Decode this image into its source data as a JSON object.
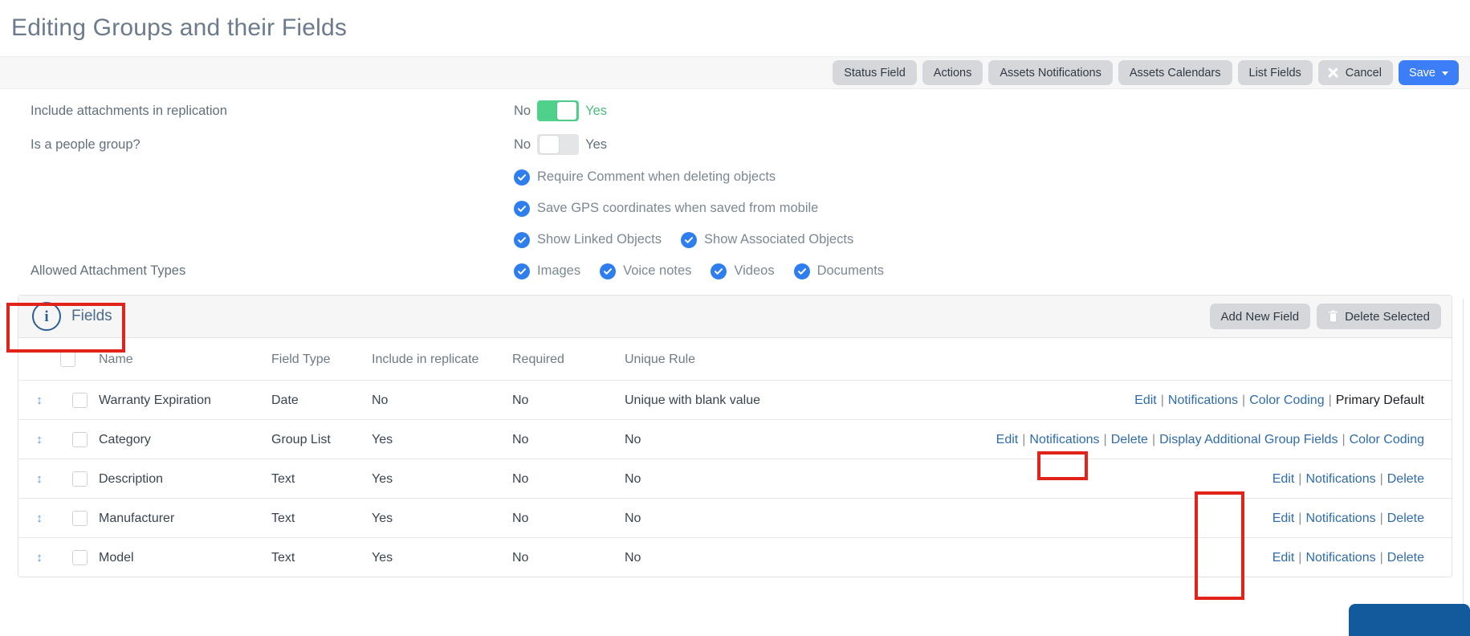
{
  "page_title": "Editing Groups and their Fields",
  "toolbar": {
    "buttons": [
      {
        "label": "Status Field"
      },
      {
        "label": "Actions"
      },
      {
        "label": "Assets Notifications"
      },
      {
        "label": "Assets Calendars"
      },
      {
        "label": "List Fields"
      }
    ],
    "cancel_label": "Cancel",
    "save_label": "Save"
  },
  "settings": {
    "rows": [
      {
        "label": "Include attachments in replication",
        "off_label": "No",
        "on_label": "Yes",
        "state": "on"
      },
      {
        "label": "Is a people group?",
        "off_label": "No",
        "on_label": "Yes",
        "state": "off"
      }
    ],
    "checkboxes": [
      {
        "label": "Require Comment when deleting objects",
        "checked": true
      },
      {
        "label": "Save GPS coordinates when saved from mobile",
        "checked": true
      }
    ],
    "object_options": [
      {
        "label": "Show Linked Objects",
        "checked": true
      },
      {
        "label": "Show Associated Objects",
        "checked": true
      }
    ],
    "attachment_types_label": "Allowed Attachment Types",
    "attachment_types": [
      {
        "label": "Images",
        "checked": true
      },
      {
        "label": "Voice notes",
        "checked": true
      },
      {
        "label": "Videos",
        "checked": true
      },
      {
        "label": "Documents",
        "checked": true
      }
    ]
  },
  "fields_panel": {
    "title": "Fields",
    "info_icon_glyph": "i",
    "add_new_field_label": "Add New Field",
    "delete_selected_label": "Delete Selected",
    "columns": [
      "Name",
      "Field Type",
      "Include in replicate",
      "Required",
      "Unique Rule"
    ],
    "rows": [
      {
        "name": "Warranty Expiration",
        "field_type": "Date",
        "include_in_replicate": "No",
        "required": "No",
        "unique_rule": "Unique with blank value",
        "actions": [
          {
            "label": "Edit",
            "type": "link"
          },
          {
            "label": "Notifications",
            "type": "link"
          },
          {
            "label": "Color Coding",
            "type": "link"
          },
          {
            "label": "Primary Default",
            "type": "static"
          }
        ]
      },
      {
        "name": "Category",
        "field_type": "Group List",
        "include_in_replicate": "Yes",
        "required": "No",
        "unique_rule": "No",
        "actions": [
          {
            "label": "Edit",
            "type": "link"
          },
          {
            "label": "Notifications",
            "type": "link"
          },
          {
            "label": "Delete",
            "type": "link"
          },
          {
            "label": "Display Additional Group Fields",
            "type": "link"
          },
          {
            "label": "Color Coding",
            "type": "link"
          }
        ]
      },
      {
        "name": "Description",
        "field_type": "Text",
        "include_in_replicate": "Yes",
        "required": "No",
        "unique_rule": "No",
        "actions": [
          {
            "label": "Edit",
            "type": "link"
          },
          {
            "label": "Notifications",
            "type": "link"
          },
          {
            "label": "Delete",
            "type": "link"
          }
        ]
      },
      {
        "name": "Manufacturer",
        "field_type": "Text",
        "include_in_replicate": "Yes",
        "required": "No",
        "unique_rule": "No",
        "actions": [
          {
            "label": "Edit",
            "type": "link"
          },
          {
            "label": "Notifications",
            "type": "link"
          },
          {
            "label": "Delete",
            "type": "link"
          }
        ]
      },
      {
        "name": "Model",
        "field_type": "Text",
        "include_in_replicate": "Yes",
        "required": "No",
        "unique_rule": "No",
        "actions": [
          {
            "label": "Edit",
            "type": "link"
          },
          {
            "label": "Notifications",
            "type": "link"
          },
          {
            "label": "Delete",
            "type": "link"
          }
        ]
      }
    ],
    "action_separator": "|",
    "drag_handle_glyph": "↕"
  },
  "annotations": {
    "color": "#e2231a",
    "boxes": [
      "fields-section-header",
      "category-delete-link",
      "delete-links-column"
    ]
  },
  "colors": {
    "accent_blue": "#3b7ef7",
    "link_blue": "#2f6cab",
    "toggle_green": "#4fd18b",
    "annotation_red": "#e2231a",
    "chat_widget_blue": "#125a9c"
  }
}
